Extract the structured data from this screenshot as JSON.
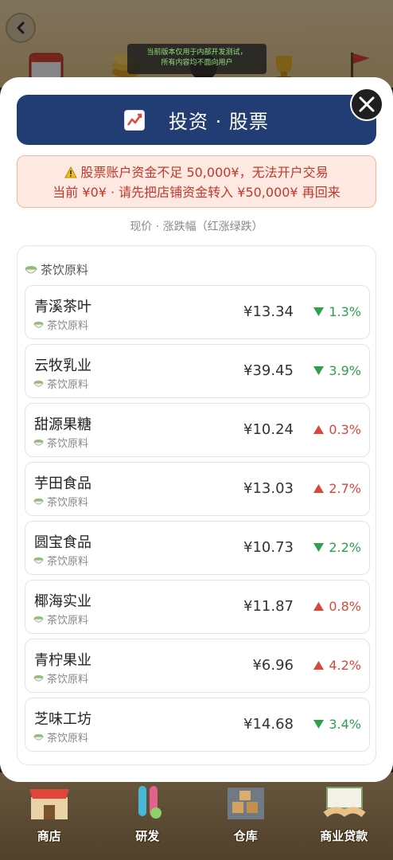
{
  "dev_notice": {
    "line1": "当前版本仅用于内部开发测试，",
    "line2": "所有内容均不面向用户"
  },
  "modal": {
    "title": "投资 · 股票",
    "warning": {
      "line1": "股票账户资金不足 50,000¥，无法开户交易",
      "line2": "当前 ¥0¥ · 请先把店铺资金转入 ¥50,000¥ 再回来"
    },
    "subtitle": "现价 · 涨跌幅（红涨绿跌）",
    "category": "茶饮原料",
    "stocks": [
      {
        "name": "青溪茶叶",
        "category": "茶饮原料",
        "price": "¥13.34",
        "direction": "down",
        "change": "1.3%"
      },
      {
        "name": "云牧乳业",
        "category": "茶饮原料",
        "price": "¥39.45",
        "direction": "down",
        "change": "3.9%"
      },
      {
        "name": "甜源果糖",
        "category": "茶饮原料",
        "price": "¥10.24",
        "direction": "up",
        "change": "0.3%"
      },
      {
        "name": "芋田食品",
        "category": "茶饮原料",
        "price": "¥13.03",
        "direction": "up",
        "change": "2.7%"
      },
      {
        "name": "圆宝食品",
        "category": "茶饮原料",
        "price": "¥10.73",
        "direction": "down",
        "change": "2.2%"
      },
      {
        "name": "椰海实业",
        "category": "茶饮原料",
        "price": "¥11.87",
        "direction": "up",
        "change": "0.8%"
      },
      {
        "name": "青柠果业",
        "category": "茶饮原料",
        "price": "¥6.96",
        "direction": "up",
        "change": "4.2%"
      },
      {
        "name": "芝味工坊",
        "category": "茶饮原料",
        "price": "¥14.68",
        "direction": "down",
        "change": "3.4%"
      }
    ]
  },
  "bottom_nav": [
    {
      "label": "商店",
      "icon": "shop-icon"
    },
    {
      "label": "研发",
      "icon": "research-icon"
    },
    {
      "label": "仓库",
      "icon": "warehouse-icon"
    },
    {
      "label": "商业贷款",
      "icon": "loan-icon"
    }
  ],
  "colors": {
    "up": "#d9463b",
    "down": "#2e9e4f",
    "title_bar": "#223d74"
  }
}
